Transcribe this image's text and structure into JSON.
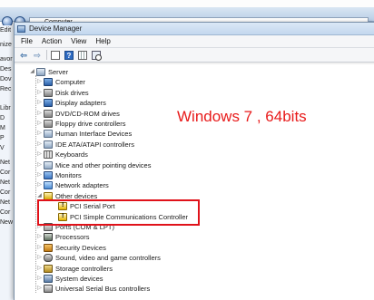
{
  "background_window": {
    "address": "Computer",
    "left_pane_items": [
      "Edit",
      "",
      "nize",
      "",
      "avor",
      "Des",
      "Dov",
      "Rec",
      "",
      "",
      "Libr",
      "D",
      "M",
      "P",
      "V",
      "",
      "Net",
      "Cor",
      "Net",
      "Cor",
      "Net",
      "Cor",
      "New"
    ]
  },
  "device_manager": {
    "title": "Device Manager",
    "menu": [
      "File",
      "Action",
      "View",
      "Help"
    ],
    "root": "Server",
    "categories": [
      {
        "label": "Computer",
        "icon": "computer-icon"
      },
      {
        "label": "Disk drives",
        "icon": "disk-drive-icon"
      },
      {
        "label": "Display adapters",
        "icon": "display-adapter-icon"
      },
      {
        "label": "DVD/CD-ROM drives",
        "icon": "dvd-drive-icon"
      },
      {
        "label": "Floppy drive controllers",
        "icon": "floppy-controller-icon"
      },
      {
        "label": "Human Interface Devices",
        "icon": "hid-icon"
      },
      {
        "label": "IDE ATA/ATAPI controllers",
        "icon": "ide-controller-icon"
      },
      {
        "label": "Keyboards",
        "icon": "keyboard-icon"
      },
      {
        "label": "Mice and other pointing devices",
        "icon": "mouse-icon"
      },
      {
        "label": "Monitors",
        "icon": "monitor-icon"
      },
      {
        "label": "Network adapters",
        "icon": "network-adapter-icon"
      },
      {
        "label": "Other devices",
        "icon": "other-devices-icon",
        "expanded": true,
        "children": [
          {
            "label": "PCI Serial Port",
            "icon": "warning-device-icon"
          },
          {
            "label": "PCI Simple Communications Controller",
            "icon": "warning-device-icon"
          }
        ]
      },
      {
        "label": "Ports (COM & LPT)",
        "icon": "ports-icon"
      },
      {
        "label": "Processors",
        "icon": "processor-icon"
      },
      {
        "label": "Security Devices",
        "icon": "security-device-icon"
      },
      {
        "label": "Sound, video and game controllers",
        "icon": "sound-icon"
      },
      {
        "label": "Storage controllers",
        "icon": "storage-controller-icon"
      },
      {
        "label": "System devices",
        "icon": "system-device-icon"
      },
      {
        "label": "Universal Serial Bus controllers",
        "icon": "usb-icon"
      }
    ]
  },
  "annotation": {
    "text": "Windows 7 , 64bits",
    "color": "#e81a1a"
  },
  "highlight_color": "#e0121a"
}
